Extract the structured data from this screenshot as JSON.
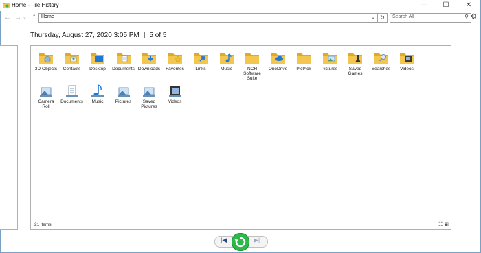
{
  "window": {
    "title": "Home - File History",
    "minimize": "—",
    "maximize": "☐",
    "close": "✕"
  },
  "nav": {
    "back": "←",
    "forward": "→",
    "up": "↑",
    "address": "Home",
    "search_placeholder": "Search All",
    "refresh": "↻",
    "settings": "⚙"
  },
  "snapshot": {
    "date": "Thursday, August 27, 2020 3:05 PM",
    "separator": "|",
    "position": "5 of 5"
  },
  "items": [
    {
      "label": "3D Objects",
      "icon": "folder-3d-objects-icon"
    },
    {
      "label": "Contacts",
      "icon": "folder-contacts-icon"
    },
    {
      "label": "Desktop",
      "icon": "folder-desktop-icon"
    },
    {
      "label": "Documents",
      "icon": "folder-documents-icon"
    },
    {
      "label": "Downloads",
      "icon": "folder-downloads-icon"
    },
    {
      "label": "Favorites",
      "icon": "folder-favorites-icon"
    },
    {
      "label": "Links",
      "icon": "folder-links-icon"
    },
    {
      "label": "Music",
      "icon": "folder-music-icon"
    },
    {
      "label": "NCH Software Suite",
      "icon": "folder-icon"
    },
    {
      "label": "OneDrive",
      "icon": "folder-onedrive-icon"
    },
    {
      "label": "PicPick",
      "icon": "folder-icon"
    },
    {
      "label": "Pictures",
      "icon": "folder-pictures-icon"
    },
    {
      "label": "Saved Games",
      "icon": "folder-saved-games-icon"
    },
    {
      "label": "Searches",
      "icon": "folder-searches-icon"
    },
    {
      "label": "Videos",
      "icon": "folder-videos-icon"
    },
    {
      "label": "Camera Roll",
      "icon": "library-camera-roll-icon"
    },
    {
      "label": "Documents",
      "icon": "library-documents-icon"
    },
    {
      "label": "Music",
      "icon": "library-music-icon"
    },
    {
      "label": "Pictures",
      "icon": "library-pictures-icon"
    },
    {
      "label": "Saved Pictures",
      "icon": "library-saved-pictures-icon"
    },
    {
      "label": "Videos",
      "icon": "library-videos-icon"
    }
  ],
  "status": {
    "item_count": "21 items"
  },
  "colors": {
    "folder": "#f3c74f",
    "folder_dark": "#e0a928",
    "accent_blue": "#1e78d6",
    "restore_green": "#2db84a"
  }
}
